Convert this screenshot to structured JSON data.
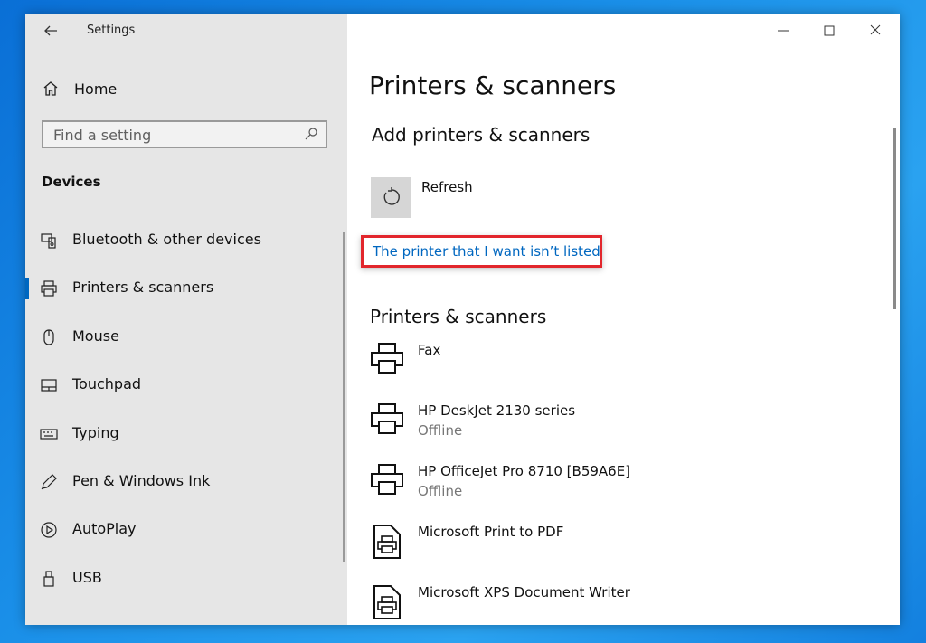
{
  "window": {
    "title": "Settings",
    "caption_buttons": [
      "minimize",
      "maximize",
      "close"
    ]
  },
  "sidebar": {
    "home_label": "Home",
    "search_placeholder": "Find a setting",
    "section_title": "Devices",
    "items": [
      {
        "label": "Bluetooth & other devices",
        "icon": "bluetooth-devices-icon"
      },
      {
        "label": "Printers & scanners",
        "icon": "printer-icon",
        "active": true
      },
      {
        "label": "Mouse",
        "icon": "mouse-icon"
      },
      {
        "label": "Touchpad",
        "icon": "touchpad-icon"
      },
      {
        "label": "Typing",
        "icon": "keyboard-icon"
      },
      {
        "label": "Pen & Windows Ink",
        "icon": "pen-icon"
      },
      {
        "label": "AutoPlay",
        "icon": "autoplay-icon"
      },
      {
        "label": "USB",
        "icon": "usb-icon"
      }
    ]
  },
  "main": {
    "page_title": "Printers & scanners",
    "add_section_title": "Add printers & scanners",
    "refresh_label": "Refresh",
    "link_label": "The printer that I want isn’t listed",
    "list_section_title": "Printers & scanners",
    "printers": [
      {
        "name": "Fax",
        "status": "",
        "icon": "printer-icon"
      },
      {
        "name": "HP DeskJet 2130 series",
        "status": "Offline",
        "icon": "printer-icon"
      },
      {
        "name": "HP OfficeJet Pro 8710 [B59A6E]",
        "status": "Offline",
        "icon": "printer-icon"
      },
      {
        "name": "Microsoft Print to PDF",
        "status": "",
        "icon": "document-printer-icon"
      },
      {
        "name": "Microsoft XPS Document Writer",
        "status": "",
        "icon": "document-printer-icon"
      }
    ]
  },
  "colors": {
    "accent": "#0067c0",
    "highlight_border": "#e2262c",
    "sidebar_bg": "#e6e6e6"
  }
}
